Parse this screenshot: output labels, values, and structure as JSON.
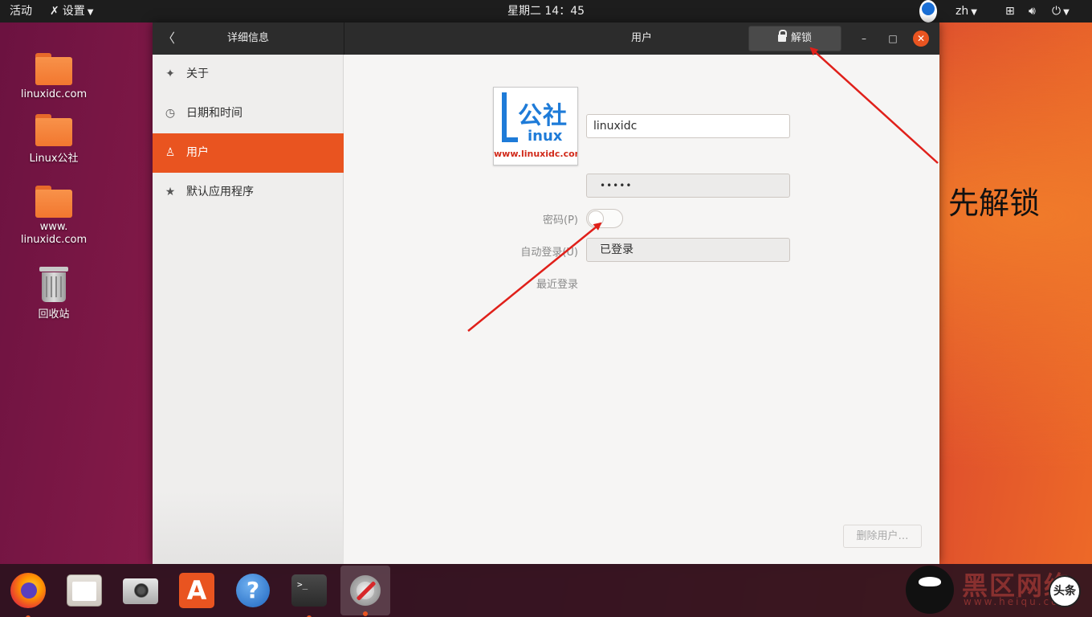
{
  "topbar": {
    "activities": "活动",
    "app_menu": "设置",
    "clock": "星期二 14：45",
    "lang": "zh"
  },
  "desktop": {
    "icons": [
      {
        "label": "linuxidc.com",
        "icon": "folder-icon"
      },
      {
        "label": "Linux公社",
        "icon": "folder-icon"
      },
      {
        "label": "www.\nlinuxidc.com",
        "icon": "folder-icon"
      },
      {
        "label": "回收站",
        "icon": "trash-icon"
      }
    ]
  },
  "window": {
    "sidebar_title": "详细信息",
    "main_title": "用户",
    "unlock_label": "解锁",
    "sidebar": {
      "items": [
        {
          "label": "关于",
          "icon": "sparkle-icon"
        },
        {
          "label": "日期和时间",
          "icon": "clock-icon"
        },
        {
          "label": "用户",
          "icon": "person-icon",
          "active": true
        },
        {
          "label": "默认应用程序",
          "icon": "star-icon"
        }
      ]
    },
    "user": {
      "avatar_text_main": "公社",
      "avatar_text_sub": "inux",
      "avatar_url": "www.linuxidc.com",
      "username": "linuxidc",
      "password_label": "密码(P)",
      "password_value": "•••••",
      "autologin_label": "自动登录(U)",
      "autologin_on": false,
      "last_login_label": "最近登录",
      "last_login_value": "已登录",
      "delete_label": "删除用户…"
    }
  },
  "annotation": {
    "text": "先解锁",
    "color": "#e0201a"
  },
  "dock": {
    "apps": [
      {
        "name": "Firefox",
        "icon": "firefox-icon",
        "running": true
      },
      {
        "name": "Files",
        "icon": "files-icon",
        "running": false
      },
      {
        "name": "Cheese",
        "icon": "camera-icon",
        "running": false
      },
      {
        "name": "Software",
        "icon": "software-store-icon",
        "running": false
      },
      {
        "name": "Help",
        "icon": "help-icon",
        "running": false
      },
      {
        "name": "Terminal",
        "icon": "terminal-icon",
        "running": true
      },
      {
        "name": "Settings",
        "icon": "settings-icon",
        "running": true
      }
    ],
    "terminal_prompt": ">_",
    "help_glyph": "?",
    "store_glyph": "A"
  },
  "watermark": {
    "text": "黑区网络",
    "url": "www.heiqu.com",
    "badge": "头条"
  },
  "colors": {
    "accent": "#e95420",
    "titlebar": "#2c2c2c",
    "topbar": "#1d1d1d"
  }
}
